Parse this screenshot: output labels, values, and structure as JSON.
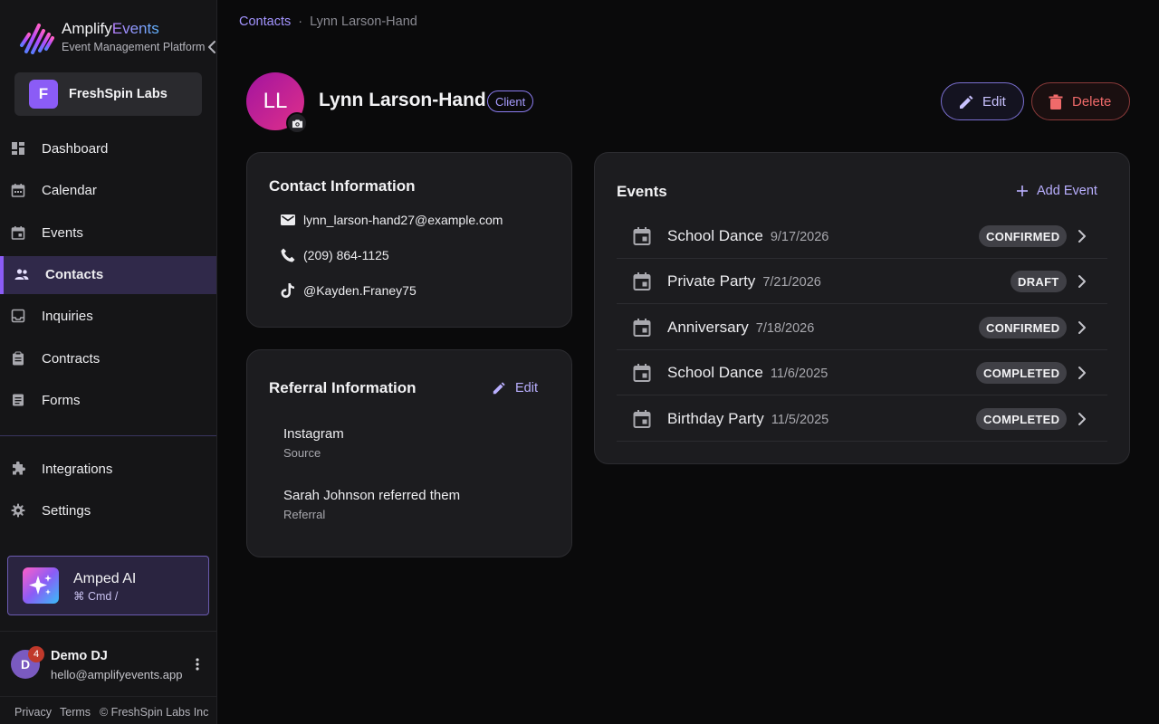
{
  "brand": {
    "name_prefix": "Amplify",
    "name_accent": "Events",
    "subtitle": "Event Management Platform"
  },
  "org": {
    "initial": "F",
    "name": "FreshSpin Labs"
  },
  "nav": {
    "main": [
      {
        "label": "Dashboard",
        "icon": "dashboard-icon"
      },
      {
        "label": "Calendar",
        "icon": "calendar-icon"
      },
      {
        "label": "Events",
        "icon": "event-icon"
      },
      {
        "label": "Contacts",
        "icon": "contacts-icon",
        "active": true
      },
      {
        "label": "Inquiries",
        "icon": "inbox-icon"
      },
      {
        "label": "Contracts",
        "icon": "clipboard-icon"
      },
      {
        "label": "Forms",
        "icon": "form-icon"
      }
    ],
    "secondary": [
      {
        "label": "Integrations",
        "icon": "puzzle-icon"
      },
      {
        "label": "Settings",
        "icon": "gear-icon"
      }
    ]
  },
  "ai": {
    "title": "Amped AI",
    "shortcut": "⌘ Cmd /"
  },
  "user": {
    "initial": "D",
    "notification_count": "4",
    "name": "Demo DJ",
    "email": "hello@amplifyevents.app"
  },
  "footer": {
    "privacy": "Privacy",
    "terms": "Terms",
    "copyright": "© FreshSpin Labs Inc"
  },
  "breadcrumb": {
    "parent": "Contacts",
    "separator": "·",
    "current": "Lynn Larson-Hand"
  },
  "contact": {
    "initials": "LL",
    "name": "Lynn Larson-Hand",
    "type": "Client"
  },
  "actions": {
    "edit": "Edit",
    "delete": "Delete"
  },
  "contact_info": {
    "title": "Contact Information",
    "email": "lynn_larson-hand27@example.com",
    "phone": "(209) 864-1125",
    "tiktok": "@Kayden.Franey75"
  },
  "referral": {
    "title": "Referral Information",
    "edit_label": "Edit",
    "source_value": "Instagram",
    "source_label": "Source",
    "referral_value": "Sarah Johnson referred them",
    "referral_label": "Referral"
  },
  "events": {
    "title": "Events",
    "add_label": "Add Event",
    "items": [
      {
        "name": "School Dance",
        "date": "9/17/2026",
        "status": "CONFIRMED"
      },
      {
        "name": "Private Party",
        "date": "7/21/2026",
        "status": "DRAFT"
      },
      {
        "name": "Anniversary",
        "date": "7/18/2026",
        "status": "CONFIRMED"
      },
      {
        "name": "School Dance",
        "date": "11/6/2025",
        "status": "COMPLETED"
      },
      {
        "name": "Birthday Party",
        "date": "11/5/2025",
        "status": "COMPLETED"
      }
    ]
  },
  "colors": {
    "accent": "#8b5cf6",
    "danger": "#f06a6a",
    "background": "#0a0a0b",
    "card": "#1c1c1f"
  }
}
